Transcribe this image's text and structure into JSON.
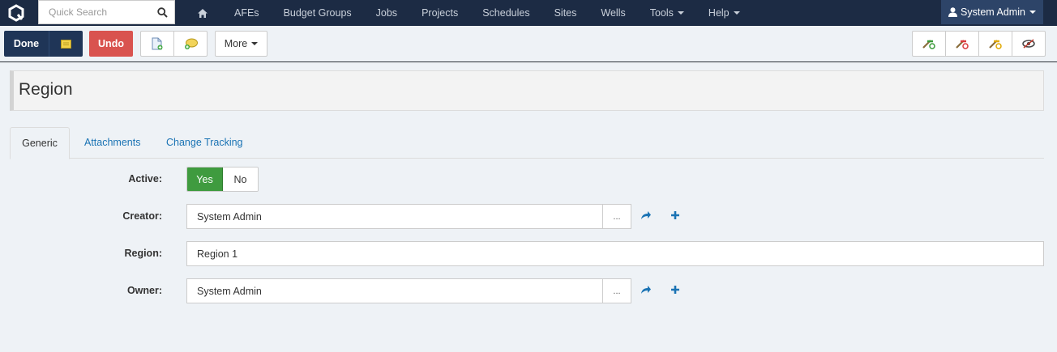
{
  "nav": {
    "search_placeholder": "Quick Search",
    "links": [
      "AFEs",
      "Budget Groups",
      "Jobs",
      "Projects",
      "Schedules",
      "Sites",
      "Wells",
      "Tools",
      "Help"
    ],
    "user": "System Admin"
  },
  "toolbar": {
    "done_label": "Done",
    "undo_label": "Undo",
    "more_label": "More"
  },
  "page": {
    "title": "Region"
  },
  "tabs": [
    "Generic",
    "Attachments",
    "Change Tracking"
  ],
  "form": {
    "active_label": "Active:",
    "active_yes": "Yes",
    "active_no": "No",
    "creator_label": "Creator:",
    "creator_value": "System Admin",
    "region_label": "Region:",
    "region_value": "Region 1",
    "owner_label": "Owner:",
    "owner_value": "System Admin",
    "lookup_label": "..."
  },
  "colors": {
    "navbar": "#1c2b44",
    "primary_button": "#1f3557",
    "danger_button": "#d9534f",
    "toggle_on": "#3f9b3f",
    "link": "#1a73b4"
  }
}
